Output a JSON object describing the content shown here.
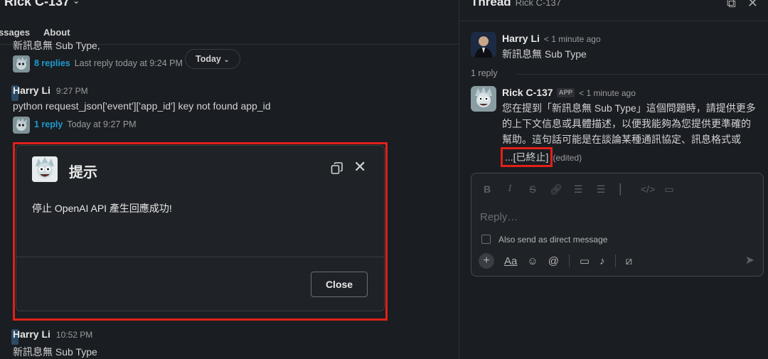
{
  "channel": {
    "title": "Rick C-137",
    "tabs": [
      "ssages",
      "About"
    ],
    "msg1_text": "新訊息無 Sub Type,",
    "msg1_replies": "8 replies",
    "msg1_last": "Last reply today at 9:24 PM",
    "today_pill": "Today",
    "msg2_author": "Harry Li",
    "msg2_time": "9:27 PM",
    "msg2_text": "python request_json['event']['app_id'] key not found app_id",
    "msg2_replies": "1 reply",
    "msg2_last": "Today at 9:27 PM",
    "msg3_author": "Harry Li",
    "msg3_time": "10:52 PM",
    "msg3_text": "新訊息無 Sub Type"
  },
  "thread": {
    "title": "Thread",
    "subtitle": "Rick C-137",
    "parent": {
      "author": "Harry Li",
      "time": "1 minute ago",
      "text": "新訊息無 Sub Type"
    },
    "reply_count": "1 reply",
    "reply": {
      "author": "Rick C-137",
      "badge": "APP",
      "time": "1 minute ago",
      "text": "您在提到「新訊息無 Sub Type」這個問題時，請提供更多的上下文信息或具體描述，以便我能夠為您提供更準確的幫助。這句話可能是在談論某種通訊協定、訊息格式或",
      "stopped": "...[已終止]",
      "edited": "(edited)"
    },
    "composer": {
      "placeholder": "Reply…",
      "dm_label": "Also send as direct message"
    }
  },
  "modal": {
    "title": "提示",
    "body": "停止 OpenAI API 產生回應成功!",
    "close_label": "Close"
  },
  "colors": {
    "background": "#1a1d21",
    "link": "#1d9bd1",
    "highlight": "#e0201a"
  }
}
